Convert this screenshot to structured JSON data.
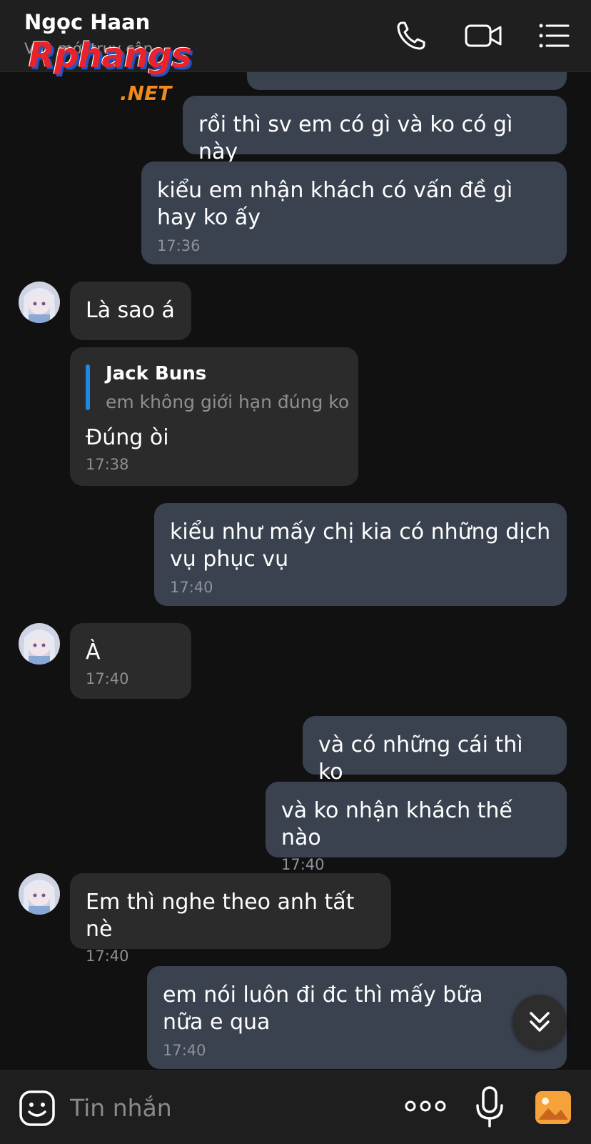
{
  "header": {
    "contact_name": "Ngọc Haan",
    "status": "Vừa mới truy cập"
  },
  "watermark": {
    "brand": "Rphangs",
    "suffix": ".NET"
  },
  "messages": [
    {
      "direction": "out",
      "text": "rồi thì sv em có gì và ko có gì này",
      "time": ""
    },
    {
      "direction": "out",
      "text": "kiểu em nhận khách có vấn đề gì hay ko ấy",
      "time": "17:36"
    },
    {
      "direction": "in",
      "text": "Là sao á",
      "time": ""
    },
    {
      "direction": "in",
      "reply_to": {
        "author": "Jack Buns",
        "text": "em không giới hạn đúng ko"
      },
      "text": "Đúng òi",
      "time": "17:38"
    },
    {
      "direction": "out",
      "text": "kiểu như mấy chị kia có những dịch vụ phục vụ",
      "time": "17:40"
    },
    {
      "direction": "in",
      "text": "À",
      "time": "17:40"
    },
    {
      "direction": "out",
      "text": "và có những cái thì ko",
      "time": ""
    },
    {
      "direction": "out",
      "text": "và ko nhận khách thế nào",
      "time": "17:40"
    },
    {
      "direction": "in",
      "text": "Em thì nghe theo anh tất nè",
      "time": "17:40"
    },
    {
      "direction": "out",
      "text": "em nói luôn đi đc thì mấy bữa nữa e qua",
      "time": "17:40"
    }
  ],
  "composer": {
    "placeholder": "Tin nhắn"
  },
  "icons": {
    "call": "phone-icon",
    "video": "video-camera-icon",
    "menu": "list-menu-icon",
    "emoji": "emoji-icon",
    "more": "more-dots-icon",
    "voice": "microphone-icon",
    "image": "image-gallery-icon",
    "scroll": "chevron-double-down-icon"
  },
  "colors": {
    "background": "#111111",
    "outgoing_bubble": "#3a4250",
    "incoming_bubble": "#2b2b2b",
    "reply_accent": "#1e88e5",
    "image_button": "#f5a23a"
  }
}
